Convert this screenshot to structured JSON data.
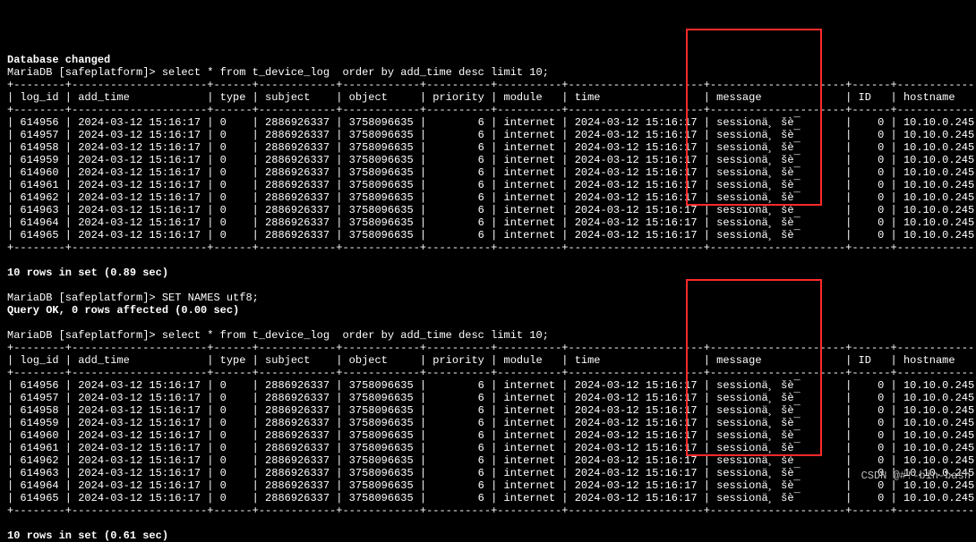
{
  "status_msg": "Database changed",
  "prompt": "MariaDB [safeplatform]> ",
  "query1": "select * from t_device_log  order by add_time desc limit 10;",
  "set_names_cmd": "SET NAMES utf8;",
  "set_names_result": "Query OK, 0 rows affected (0.00 sec)",
  "rows_result1": "10 rows in set (0.89 sec)",
  "rows_result2": "10 rows in set (0.61 sec)",
  "columns": [
    "log_id",
    "add_time",
    "type",
    "subject",
    "object",
    "priority",
    "module",
    "time",
    "message",
    "ID",
    "hostname"
  ],
  "border_top": "+--------+---------------------+------+------------+------------+----------+----------+---------------------+---------------------+------+-------------+",
  "rows1": [
    {
      "log_id": "614956",
      "add_time": "2024-03-12 15:16:17",
      "type": "0",
      "subject": "2886926337",
      "object": "3758096635",
      "priority": "6",
      "module": "internet",
      "time": "2024-03-12 15:16:17",
      "message": "sessionä¸ šè¯",
      "id": "0",
      "hostname": "10.10.0.245"
    },
    {
      "log_id": "614957",
      "add_time": "2024-03-12 15:16:17",
      "type": "0",
      "subject": "2886926337",
      "object": "3758096635",
      "priority": "6",
      "module": "internet",
      "time": "2024-03-12 15:16:17",
      "message": "sessionä¸ šè¯",
      "id": "0",
      "hostname": "10.10.0.245"
    },
    {
      "log_id": "614958",
      "add_time": "2024-03-12 15:16:17",
      "type": "0",
      "subject": "2886926337",
      "object": "3758096635",
      "priority": "6",
      "module": "internet",
      "time": "2024-03-12 15:16:17",
      "message": "sessionä¸ šè¯",
      "id": "0",
      "hostname": "10.10.0.245"
    },
    {
      "log_id": "614959",
      "add_time": "2024-03-12 15:16:17",
      "type": "0",
      "subject": "2886926337",
      "object": "3758096635",
      "priority": "6",
      "module": "internet",
      "time": "2024-03-12 15:16:17",
      "message": "sessionä¸ šè¯",
      "id": "0",
      "hostname": "10.10.0.245"
    },
    {
      "log_id": "614960",
      "add_time": "2024-03-12 15:16:17",
      "type": "0",
      "subject": "2886926337",
      "object": "3758096635",
      "priority": "6",
      "module": "internet",
      "time": "2024-03-12 15:16:17",
      "message": "sessionä¸ šè¯",
      "id": "0",
      "hostname": "10.10.0.245"
    },
    {
      "log_id": "614961",
      "add_time": "2024-03-12 15:16:17",
      "type": "0",
      "subject": "2886926337",
      "object": "3758096635",
      "priority": "6",
      "module": "internet",
      "time": "2024-03-12 15:16:17",
      "message": "sessionä¸ šè¯",
      "id": "0",
      "hostname": "10.10.0.245"
    },
    {
      "log_id": "614962",
      "add_time": "2024-03-12 15:16:17",
      "type": "0",
      "subject": "2886926337",
      "object": "3758096635",
      "priority": "6",
      "module": "internet",
      "time": "2024-03-12 15:16:17",
      "message": "sessionä¸ šè¯",
      "id": "0",
      "hostname": "10.10.0.245"
    },
    {
      "log_id": "614963",
      "add_time": "2024-03-12 15:16:17",
      "type": "0",
      "subject": "2886926337",
      "object": "3758096635",
      "priority": "6",
      "module": "internet",
      "time": "2024-03-12 15:16:17",
      "message": "sessionä¸ šè¯",
      "id": "0",
      "hostname": "10.10.0.245"
    },
    {
      "log_id": "614964",
      "add_time": "2024-03-12 15:16:17",
      "type": "0",
      "subject": "2886926337",
      "object": "3758096635",
      "priority": "6",
      "module": "internet",
      "time": "2024-03-12 15:16:17",
      "message": "sessionä¸ šè¯",
      "id": "0",
      "hostname": "10.10.0.245"
    },
    {
      "log_id": "614965",
      "add_time": "2024-03-12 15:16:17",
      "type": "0",
      "subject": "2886926337",
      "object": "3758096635",
      "priority": "6",
      "module": "internet",
      "time": "2024-03-12 15:16:17",
      "message": "sessionä¸ šè¯",
      "id": "0",
      "hostname": "10.10.0.245"
    }
  ],
  "watermark": "CSDN @#!-bin-bash"
}
